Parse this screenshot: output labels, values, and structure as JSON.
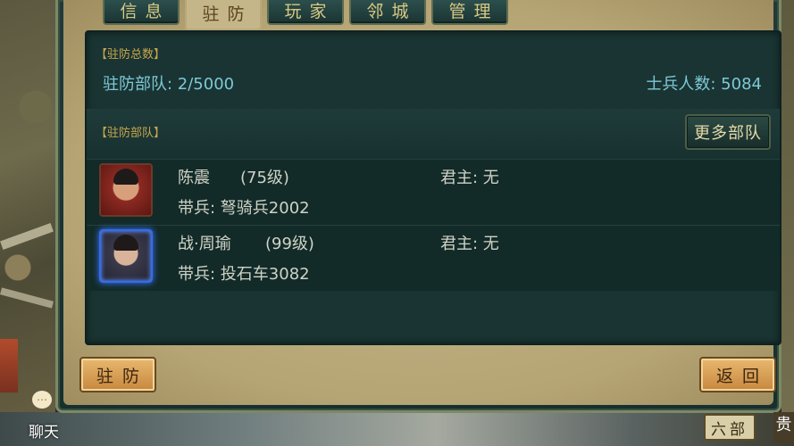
{
  "tabs": [
    {
      "label": "信息"
    },
    {
      "label": "驻防"
    },
    {
      "label": "玩家"
    },
    {
      "label": "邻城"
    },
    {
      "label": "管理"
    }
  ],
  "summary": {
    "section_label": "【驻防总数】",
    "garrison_label": "驻防部队: 2/5000",
    "soldier_label": "士兵人数: 5084"
  },
  "units_section": {
    "section_label": "【驻防部队】",
    "more_button": "更多部队"
  },
  "units": [
    {
      "name": "陈震",
      "level": "(75级)",
      "lord": "君主: 无",
      "troop": "带兵: 弩骑兵2002",
      "frame": "red"
    },
    {
      "name": "战·周瑜",
      "level": "(99级)",
      "lord": "君主: 无",
      "troop": "带兵: 投石车3082",
      "frame": "blue"
    }
  ],
  "buttons": {
    "garrison": "驻防",
    "back": "返回"
  },
  "hud": {
    "chat_label": "聊天",
    "six_label": "六部",
    "right_fragment": "贵"
  },
  "colors": {
    "accent_gold": "#c9a64e",
    "stat_cyan": "#7ec8d8",
    "button_orange": "#c7873d"
  }
}
